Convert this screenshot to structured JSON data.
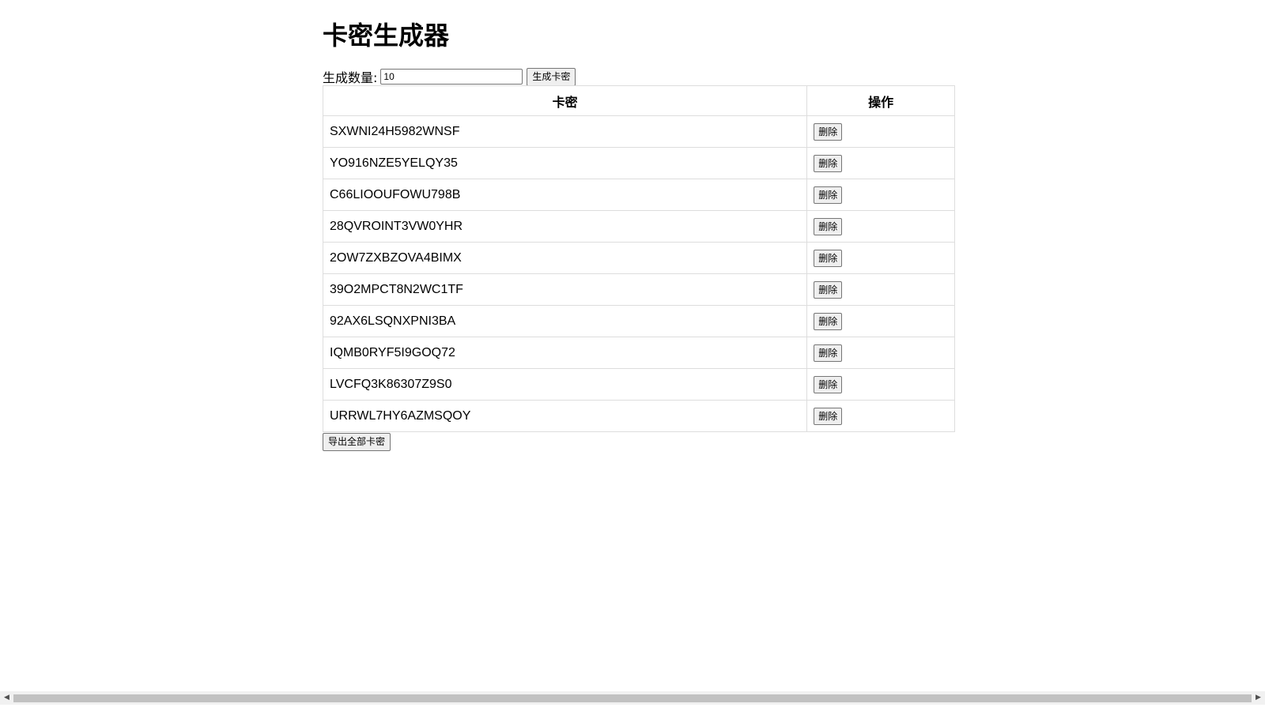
{
  "title": "卡密生成器",
  "generator": {
    "count_label": "生成数量:",
    "count_value": "10",
    "generate_button": "生成卡密"
  },
  "table": {
    "headers": [
      "卡密",
      "操作"
    ],
    "rows": [
      {
        "key": "SXWNI24H5982WNSF",
        "action": "删除"
      },
      {
        "key": "YO916NZE5YELQY35",
        "action": "删除"
      },
      {
        "key": "C66LIOOUFOWU798B",
        "action": "删除"
      },
      {
        "key": "28QVROINT3VW0YHR",
        "action": "删除"
      },
      {
        "key": "2OW7ZXBZOVA4BIMX",
        "action": "删除"
      },
      {
        "key": "39O2MPCT8N2WC1TF",
        "action": "删除"
      },
      {
        "key": "92AX6LSQNXPNI3BA",
        "action": "删除"
      },
      {
        "key": "IQMB0RYF5I9GOQ72",
        "action": "删除"
      },
      {
        "key": "LVCFQ3K86307Z9S0",
        "action": "删除"
      },
      {
        "key": "URRWL7HY6AZMSQOY",
        "action": "删除"
      }
    ]
  },
  "export_button": "导出全部卡密",
  "scrollbar": {
    "left_arrow_icon": "triangle-left-icon",
    "right_arrow_icon": "triangle-right-icon"
  }
}
